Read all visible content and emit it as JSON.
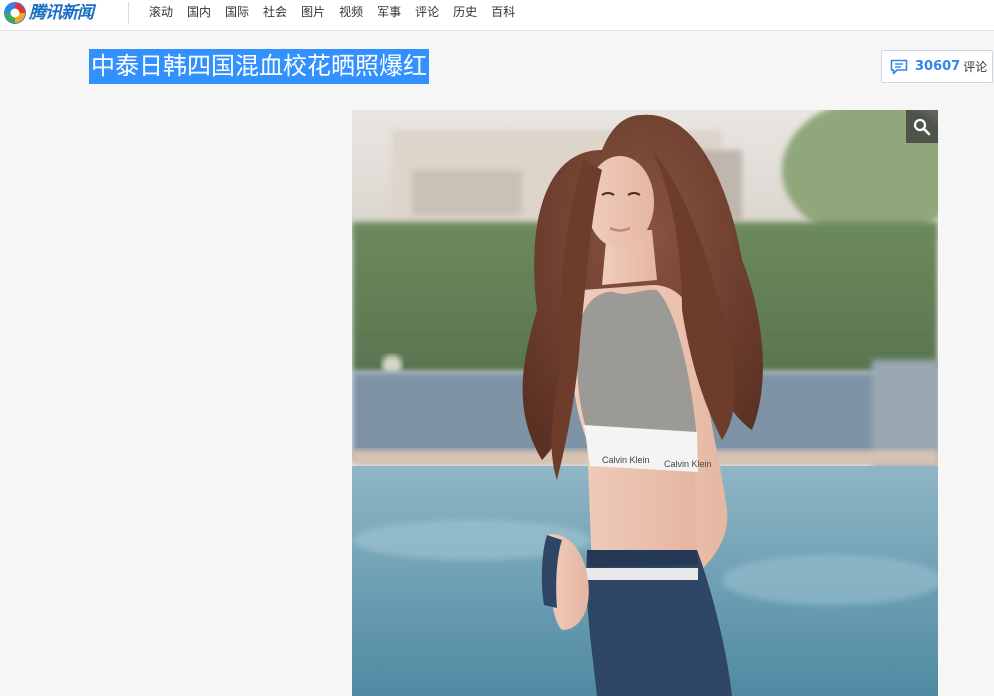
{
  "site": {
    "logo_text": "腾讯新闻",
    "logo_icon": "tencent-news-logo-icon"
  },
  "nav": {
    "items": [
      {
        "label": "滚动"
      },
      {
        "label": "国内"
      },
      {
        "label": "国际"
      },
      {
        "label": "社会"
      },
      {
        "label": "图片"
      },
      {
        "label": "视频"
      },
      {
        "label": "军事"
      },
      {
        "label": "评论"
      },
      {
        "label": "历史"
      },
      {
        "label": "百科"
      }
    ]
  },
  "article": {
    "title": "中泰日韩四国混血校花晒照爆红"
  },
  "comments": {
    "count": "30607",
    "label": "评论",
    "icon": "comment-bubble-icon"
  },
  "photo": {
    "zoom_icon": "magnifier-icon",
    "bra_band_text": "Calvin Klein"
  },
  "colors": {
    "brand_blue": "#1a6fc4",
    "highlight": "#3391ff",
    "comment_count": "#2f86e8"
  }
}
